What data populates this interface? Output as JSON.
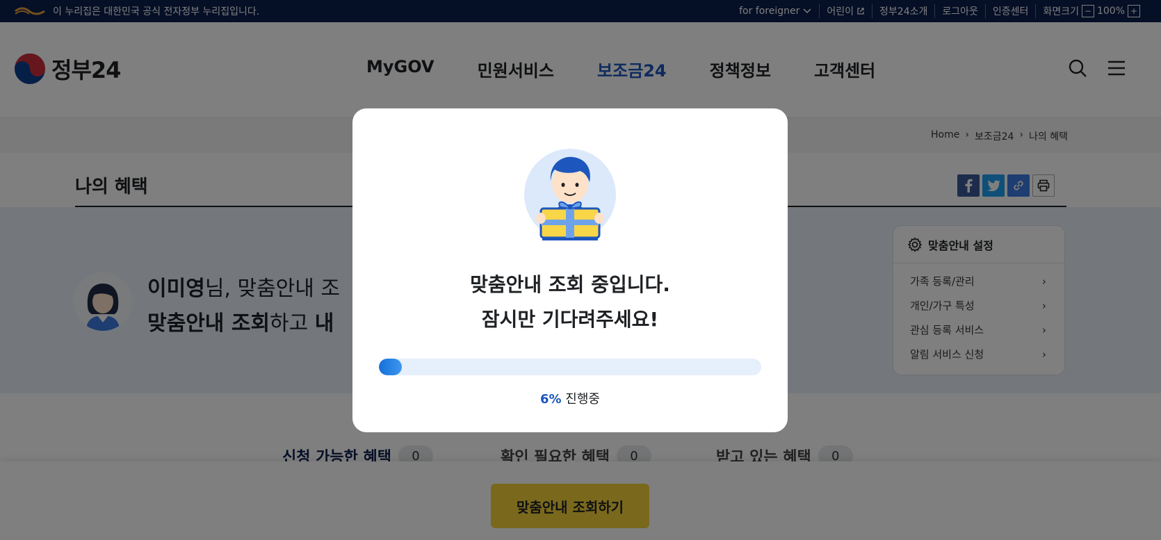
{
  "gov_bar": {
    "notice": "이 누리집은 대한민국 공식 전자정부 누리집입니다.",
    "links": [
      {
        "label": "for foreigner",
        "icon": "chevron-down-icon"
      },
      {
        "label": "어린이",
        "icon": "external-link-icon"
      },
      {
        "label": "정부24소개"
      },
      {
        "label": "로그아웃"
      },
      {
        "label": "인증센터"
      },
      {
        "label": "화면크기"
      }
    ],
    "zoom_minus": "−",
    "zoom_value": "100%",
    "zoom_plus": "+"
  },
  "header": {
    "logo_text": "정부24",
    "nav": [
      {
        "label": "MyGOV",
        "active": false
      },
      {
        "label": "민원서비스",
        "active": false
      },
      {
        "label": "보조금24",
        "active": true
      },
      {
        "label": "정책정보",
        "active": false
      },
      {
        "label": "고객센터",
        "active": false
      }
    ]
  },
  "breadcrumb": [
    "Home",
    "보조금24",
    "나의 혜택"
  ],
  "page": {
    "title": "나의 혜택",
    "greeting": {
      "name": "이미영",
      "line1_rest": "님, 맞춤안내 조",
      "line2_bold": "맞춤안내 조회",
      "line2_mid": "하고 ",
      "line2_bold2": "내"
    }
  },
  "settings": {
    "title": "맞춤안내 설정",
    "items": [
      "가족 등록/관리",
      "개인/가구 특성",
      "관심 등록 서비스",
      "알림 서비스 신청"
    ]
  },
  "tabs": [
    {
      "label": "신청 가능한 혜택",
      "count": "0"
    },
    {
      "label": "확인 필요한 혜택",
      "count": "0"
    },
    {
      "label": "받고 있는 혜택",
      "count": "0"
    }
  ],
  "cta_label": "맞춤안내 조회하기",
  "modal": {
    "line1": "맞춤안내 조회 중입니다.",
    "line2": "잠시만 기다려주세요!",
    "progress_percent": 6,
    "progress_pct_label": "6%",
    "progress_status": " 진행중"
  },
  "colors": {
    "accent": "#1d56bc",
    "gov_bar": "#0b1f4d",
    "cta": "#f5d33a"
  }
}
